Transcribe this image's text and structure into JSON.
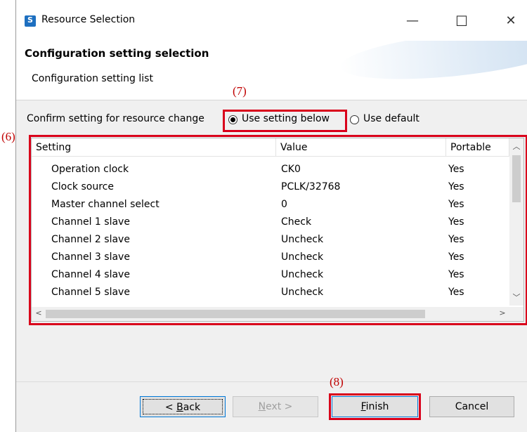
{
  "window": {
    "title": "Resource Selection",
    "minimize": "—",
    "maximize": "☐",
    "close": "✕"
  },
  "header": {
    "title": "Configuration setting selection",
    "subtitle": "Configuration setting list"
  },
  "annotations": {
    "m6": "(6)",
    "m7": "(7)",
    "m8": "(8)"
  },
  "confirm": {
    "label": "Confirm setting for resource change",
    "option_setting_below": "Use setting below",
    "option_default": "Use default",
    "selected": "Use setting below"
  },
  "table": {
    "columns": [
      "Setting",
      "Value",
      "Portable"
    ],
    "rows": [
      [
        "Operation clock",
        "CK0",
        "Yes"
      ],
      [
        "Clock source",
        "PCLK/32768",
        "Yes"
      ],
      [
        "Master channel select",
        "0",
        "Yes"
      ],
      [
        "Channel 1 slave",
        "Check",
        "Yes"
      ],
      [
        "Channel 2 slave",
        "Uncheck",
        "Yes"
      ],
      [
        "Channel 3 slave",
        "Uncheck",
        "Yes"
      ],
      [
        "Channel 4 slave",
        "Uncheck",
        "Yes"
      ],
      [
        "Channel 5 slave",
        "Uncheck",
        "Yes"
      ]
    ]
  },
  "buttons": {
    "back": {
      "mnemonic": "B",
      "rest": "ack",
      "prefix": "< "
    },
    "next": {
      "mnemonic": "N",
      "rest": "ext >"
    },
    "finish": {
      "mnemonic": "F",
      "rest": "inish"
    },
    "cancel": "Cancel"
  },
  "colors": {
    "highlight": "#d9001b",
    "annotation_text": "#c00000",
    "focus": "#0078d7"
  }
}
